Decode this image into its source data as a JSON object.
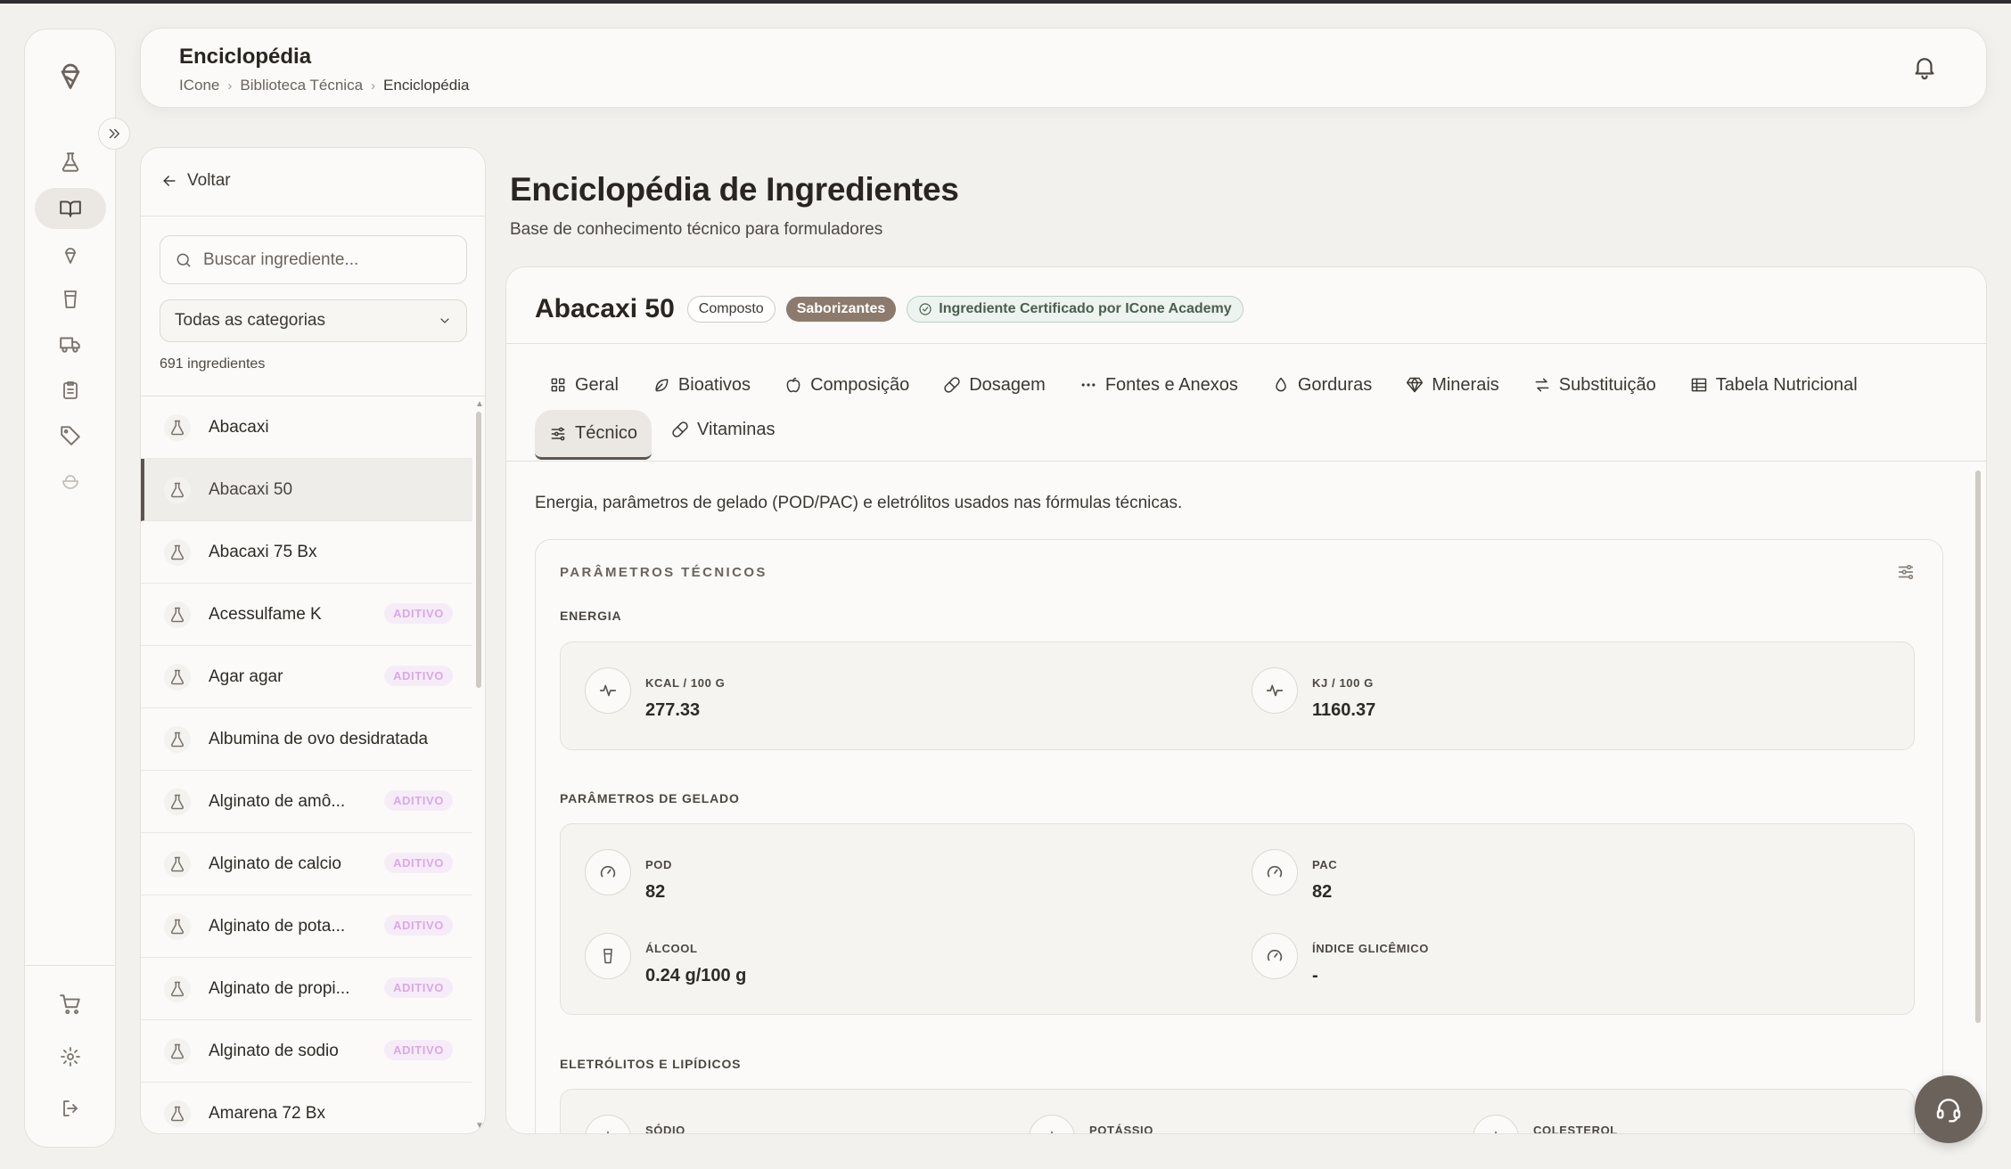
{
  "header": {
    "title": "Enciclopédia",
    "breadcrumbs": [
      "ICone",
      "Biblioteca Técnica",
      "Enciclopédia"
    ]
  },
  "sidebar": {
    "back_label": "Voltar",
    "search_placeholder": "Buscar ingrediente...",
    "category_select": "Todas as categorias",
    "count_label": "691 ingredientes",
    "items": [
      {
        "name": "Abacaxi",
        "tag": ""
      },
      {
        "name": "Abacaxi 50",
        "tag": ""
      },
      {
        "name": "Abacaxi 75 Bx",
        "tag": ""
      },
      {
        "name": "Acessulfame K",
        "tag": "ADITIVO"
      },
      {
        "name": "Agar agar",
        "tag": "ADITIVO"
      },
      {
        "name": "Albumina de ovo desidratada",
        "tag": ""
      },
      {
        "name": "Alginato de amô...",
        "tag": "ADITIVO"
      },
      {
        "name": "Alginato de calcio",
        "tag": "ADITIVO"
      },
      {
        "name": "Alginato de pota...",
        "tag": "ADITIVO"
      },
      {
        "name": "Alginato de propi...",
        "tag": "ADITIVO"
      },
      {
        "name": "Alginato de sodio",
        "tag": "ADITIVO"
      },
      {
        "name": "Amarena 72 Bx",
        "tag": ""
      }
    ],
    "selected_index": 1
  },
  "main": {
    "title": "Enciclopédia de Ingredientes",
    "subtitle": "Base de conhecimento técnico para formuladores",
    "ingredient": {
      "name": "Abacaxi 50",
      "badge_type": "Composto",
      "badge_category": "Saborizantes",
      "badge_cert": "Ingrediente Certificado por ICone Academy"
    },
    "tabs_row1": [
      {
        "label": "Geral",
        "icon": "grid-icon"
      },
      {
        "label": "Bioativos",
        "icon": "leaf-icon"
      },
      {
        "label": "Composição",
        "icon": "apple-icon"
      },
      {
        "label": "Dosagem",
        "icon": "pill-icon"
      },
      {
        "label": "Fontes e Anexos",
        "icon": "dots-icon"
      },
      {
        "label": "Gorduras",
        "icon": "drop-icon"
      },
      {
        "label": "Minerais",
        "icon": "gem-icon"
      },
      {
        "label": "Substituição",
        "icon": "swap-icon"
      },
      {
        "label": "Tabela Nutricional",
        "icon": "table-icon"
      }
    ],
    "tabs_row2": [
      {
        "label": "Técnico",
        "icon": "sliders-icon",
        "active": true
      },
      {
        "label": "Vitaminas",
        "icon": "capsule-icon",
        "active": false
      }
    ],
    "description": "Energia, parâmetros de gelado (POD/PAC) e eletrólitos usados nas fórmulas técnicas.",
    "section_title": "PARÂMETROS TÉCNICOS",
    "energy": {
      "label": "ENERGIA",
      "kcal_label": "KCAL / 100 G",
      "kcal_value": "277.33",
      "kj_label": "KJ / 100 G",
      "kj_value": "1160.37"
    },
    "gelado": {
      "label": "PARÂMETROS DE GELADO",
      "pod_label": "POD",
      "pod_value": "82",
      "pac_label": "PAC",
      "pac_value": "82",
      "alcool_label": "ÁLCOOL",
      "alcool_value": "0.24 g/100 g",
      "ig_label": "ÍNDICE GLICÊMICO",
      "ig_value": "-"
    },
    "eletrolitos": {
      "label": "ELETRÓLITOS E LIPÍDICOS",
      "sodio_label": "SÓDIO",
      "potassio_label": "POTÁSSIO",
      "colesterol_label": "COLESTEROL"
    }
  }
}
